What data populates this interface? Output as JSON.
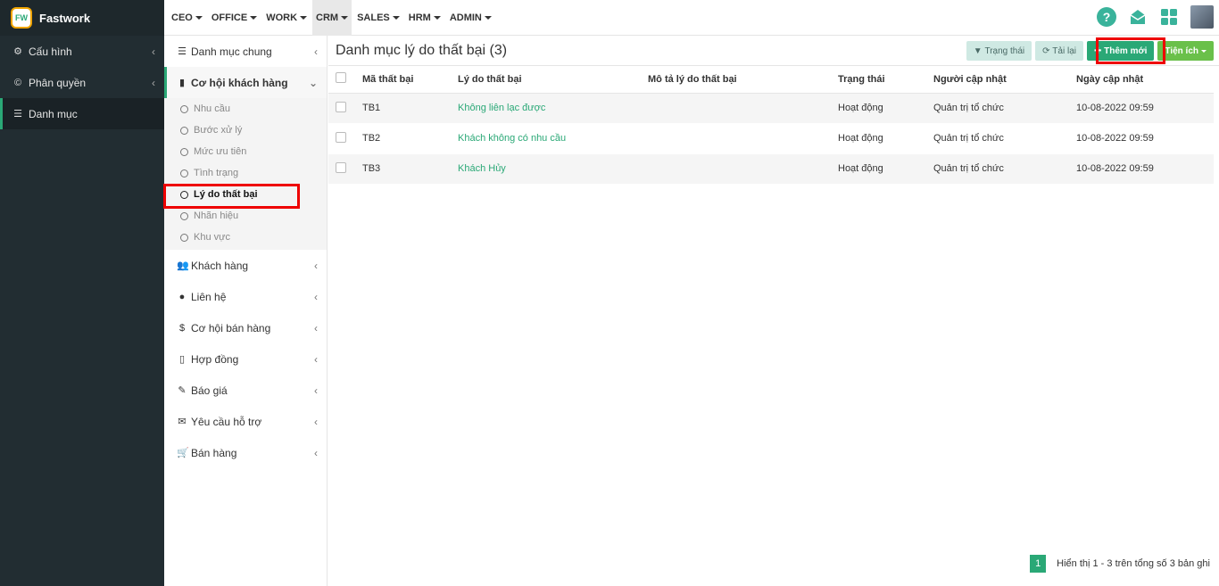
{
  "brand": {
    "name": "Fastwork",
    "logo_text": "FW"
  },
  "sidebar": {
    "items": [
      {
        "label": "Cấu hình",
        "icon": "gear-icon"
      },
      {
        "label": "Phân quyền",
        "icon": "copyright-icon"
      },
      {
        "label": "Danh mục",
        "icon": "list-icon"
      }
    ]
  },
  "topnav": {
    "items": [
      "CEO",
      "OFFICE",
      "WORK",
      "CRM",
      "SALES",
      "HRM",
      "ADMIN"
    ],
    "active": "CRM"
  },
  "subsidebar": {
    "items": [
      {
        "label": "Danh mục chung",
        "icon": "list-icon"
      },
      {
        "label": "Cơ hội khách hàng",
        "icon": "bookmark-icon"
      },
      {
        "label": "Khách hàng",
        "icon": "users-icon"
      },
      {
        "label": "Liên hệ",
        "icon": "user-icon"
      },
      {
        "label": "Cơ hội bán hàng",
        "icon": "dollar-icon"
      },
      {
        "label": "Hợp đồng",
        "icon": "file-icon"
      },
      {
        "label": "Báo giá",
        "icon": "paperclip-icon"
      },
      {
        "label": "Yêu cầu hỗ trợ",
        "icon": "comment-icon"
      },
      {
        "label": "Bán hàng",
        "icon": "cart-icon"
      }
    ],
    "children": [
      "Nhu cầu",
      "Bước xử lý",
      "Mức ưu tiên",
      "Tình trạng",
      "Lý do thất bại",
      "Nhãn hiệu",
      "Khu vực"
    ],
    "active_child": "Lý do thất bại"
  },
  "page": {
    "title": "Danh mục lý do thất bại (3)",
    "buttons": {
      "status": "Trạng thái",
      "reload": "Tải lại",
      "add": "Thêm mới",
      "utilities": "Tiện ích"
    }
  },
  "table": {
    "headers": [
      "Mã thất bại",
      "Lý do thất bại",
      "Mô tả lý do thất bại",
      "Trạng thái",
      "Người cập nhật",
      "Ngày cập nhật"
    ],
    "rows": [
      [
        "TB1",
        "Không liên lạc được",
        "",
        "Hoạt động",
        "Quản trị tổ chức",
        "10-08-2022 09:59"
      ],
      [
        "TB2",
        "Khách không có nhu cầu",
        "",
        "Hoạt động",
        "Quản trị tổ chức",
        "10-08-2022 09:59"
      ],
      [
        "TB3",
        "Khách Hủy",
        "",
        "Hoạt động",
        "Quản trị tổ chức",
        "10-08-2022 09:59"
      ]
    ]
  },
  "pagination": {
    "current": "1",
    "summary": "Hiển thị 1 - 3 trên tổng số 3 bản ghi"
  },
  "colors": {
    "accent": "#2aa876",
    "sidebar_bg": "#222d32",
    "highlight": "#ee0000"
  }
}
